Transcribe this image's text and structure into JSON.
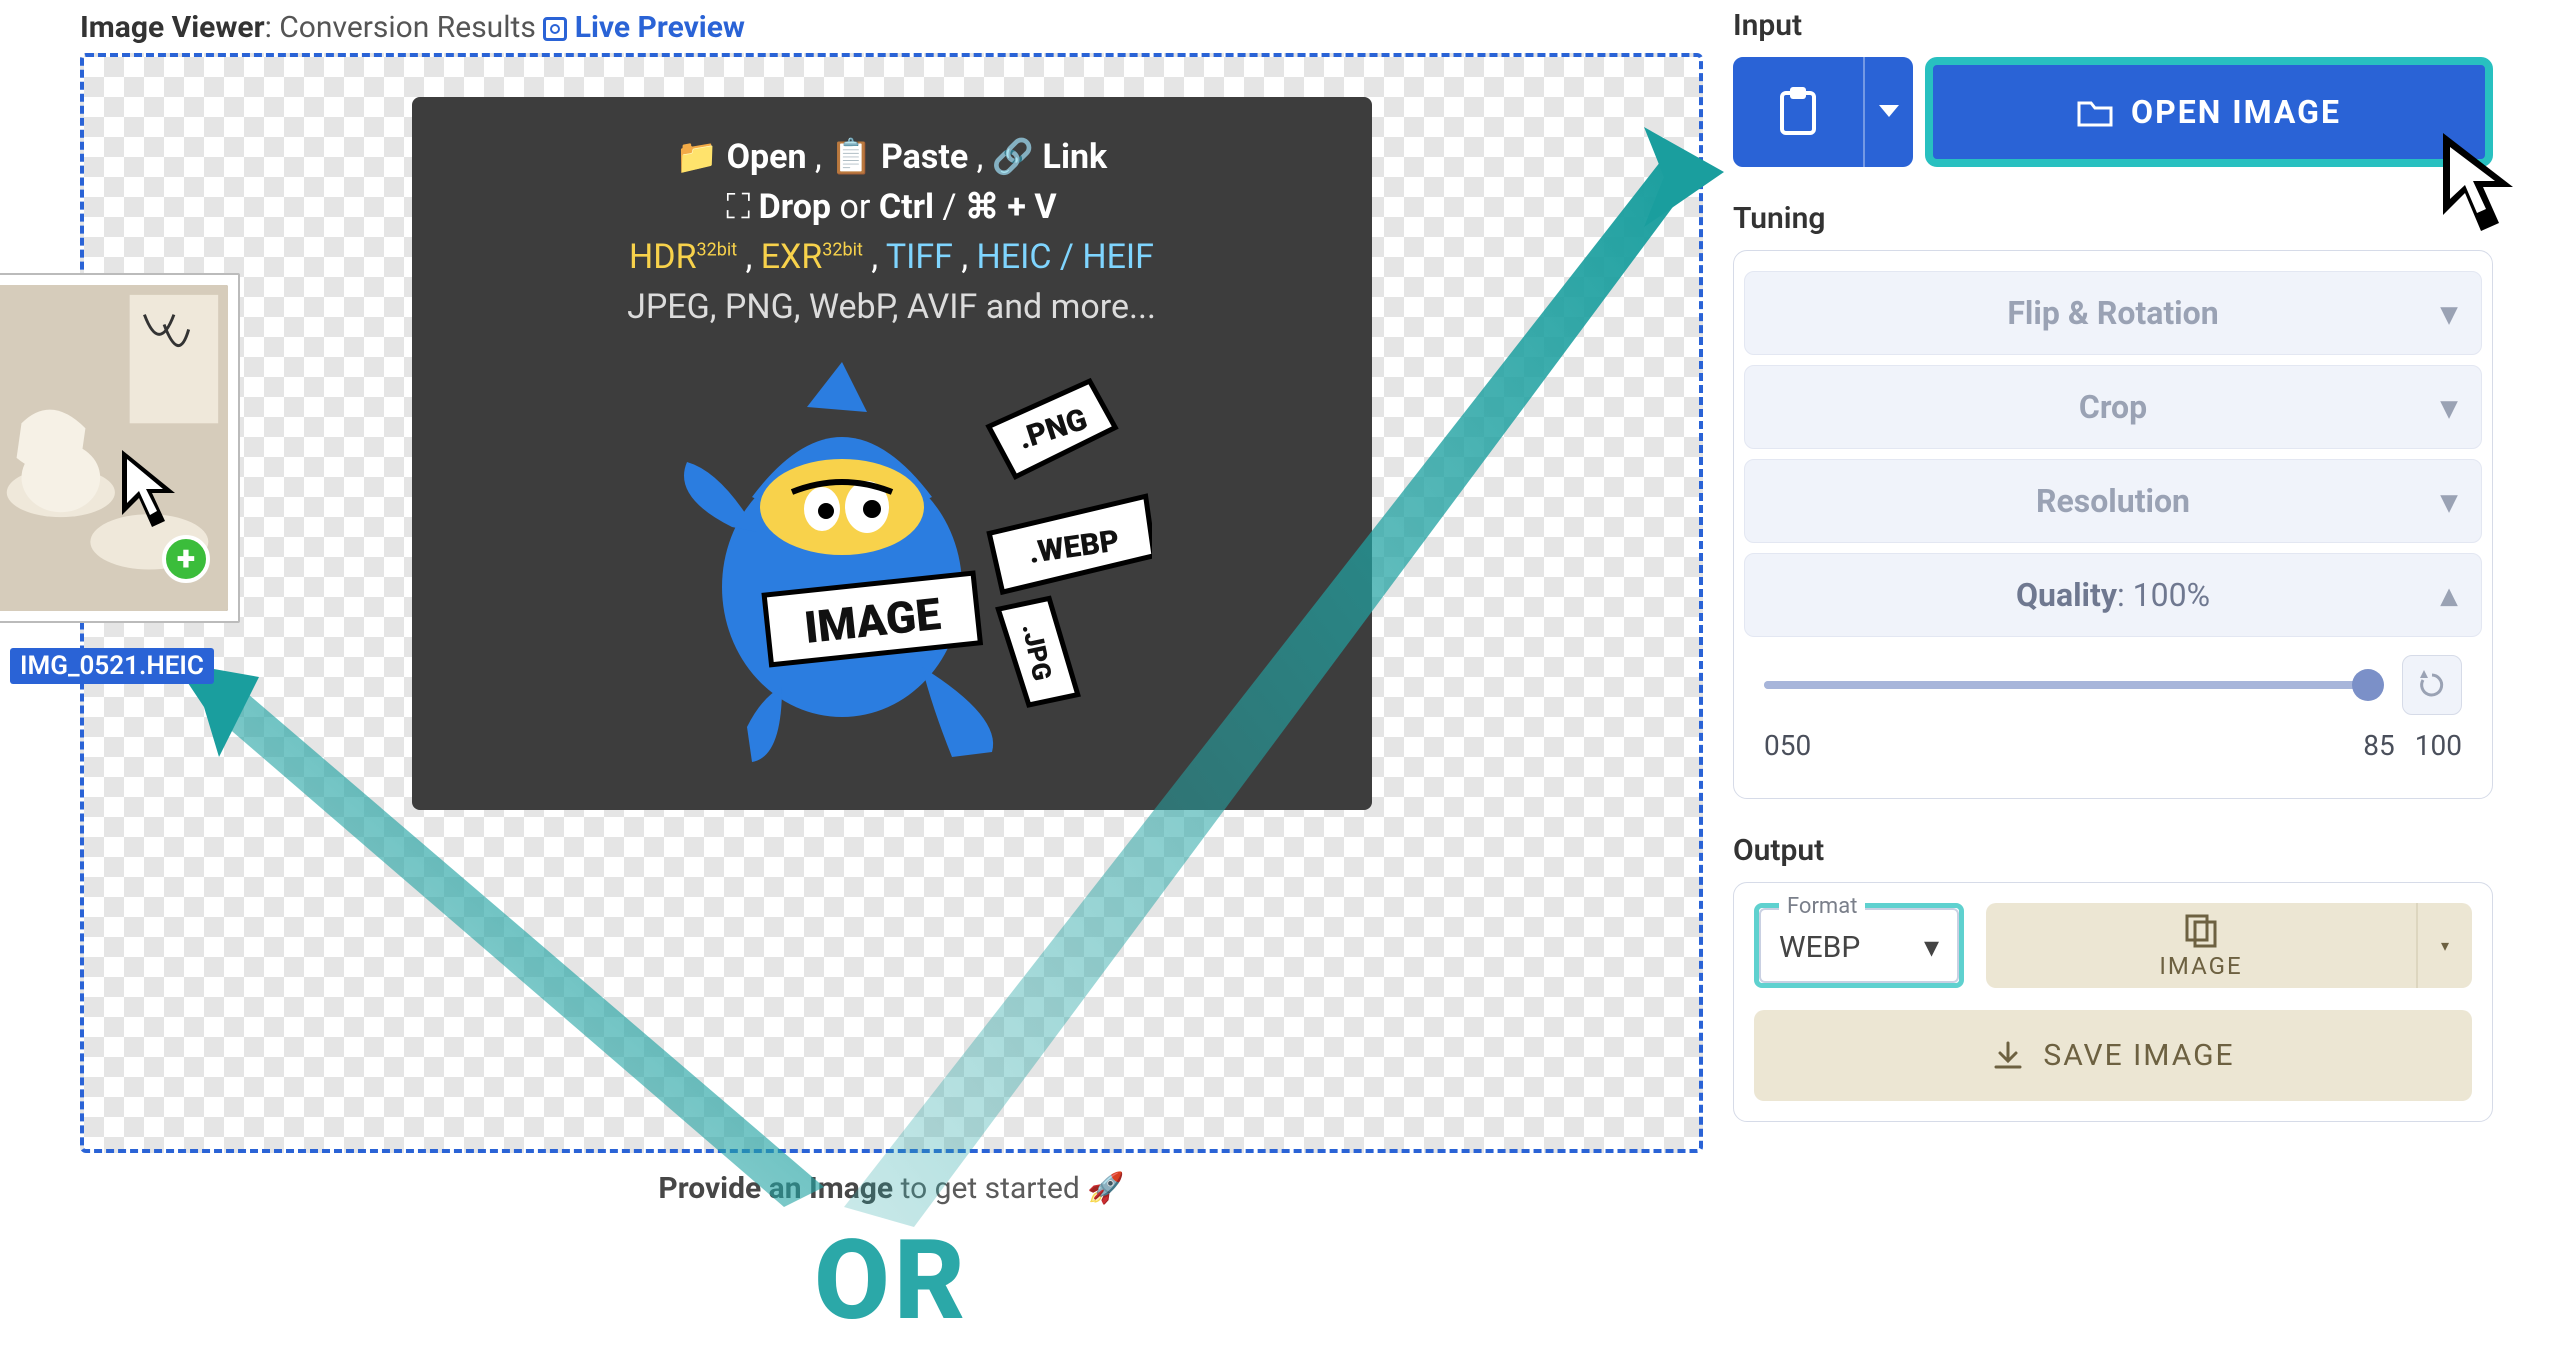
{
  "viewer": {
    "title": "Image Viewer",
    "subtitle": ": Conversion Results",
    "live_preview": "Live Preview",
    "drop_hint": {
      "row1": {
        "open": "Open",
        "paste": "Paste",
        "link": "Link"
      },
      "row2": {
        "drop": "Drop",
        "or": "or",
        "ctrl": "Ctrl",
        "combo": "+ V",
        "cmd": "⌘"
      },
      "row3": {
        "hdr": "HDR",
        "hdr_sup": "32bit",
        "exr": "EXR",
        "exr_sup": "32bit",
        "tiff": "TIFF",
        "heic": "HEIC / HEIF"
      },
      "row4": {
        "formats": "JPEG, PNG, WebP, AVIF",
        "more": " and more..."
      },
      "mascot_tags": {
        "png": ".PNG",
        "webp": ".WEBP",
        "jpg": ".JPG",
        "image": "IMAGE"
      }
    },
    "thumbnail_filename": "IMG_0521.HEIC",
    "footer": {
      "bold": "Provide an Image",
      "rest": " to get started 🚀"
    },
    "or": "OR"
  },
  "right": {
    "input_title": "Input",
    "open_image_label": "OPEN IMAGE",
    "tuning_title": "Tuning",
    "accordions": {
      "flip": "Flip & Rotation",
      "crop": "Crop",
      "resolution": "Resolution",
      "quality_label": "Quality",
      "quality_value": ": 100%"
    },
    "slider": {
      "ticks": [
        "0",
        "50",
        "85",
        "100"
      ],
      "value": 100
    },
    "output_title": "Output",
    "format_label": "Format",
    "format_value": "WEBP",
    "copy_image_label": "IMAGE",
    "save_image_label": "SAVE IMAGE"
  },
  "colors": {
    "accent": "#2a63d6",
    "teal": "#2ba8a8"
  }
}
